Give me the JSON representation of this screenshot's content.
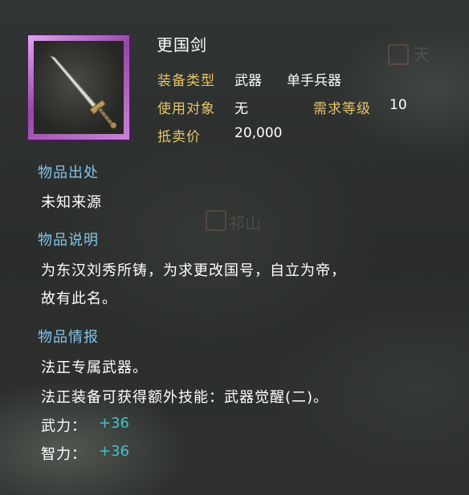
{
  "item": {
    "name": "更国剑",
    "icon": "sword-icon",
    "frame_color": "#c07ad2",
    "equip_type_label": "装备类型",
    "equip_type_value": "武器",
    "equip_subtype_value": "单手兵器",
    "user_label": "使用对象",
    "user_value": "无",
    "required_level_label": "需求等级",
    "required_level_value": "10",
    "sell_price_label": "抵卖价",
    "sell_price_value": "20,000"
  },
  "sections": {
    "origin_title": "物品出处",
    "origin_text": "未知来源",
    "description_title": "物品说明",
    "description_line1": "为东汉刘秀所铸，为求更改国号，自立为帝，",
    "description_line2": "故有此名。",
    "info_title": "物品情报",
    "info_line1": "法正专属武器。",
    "info_line2": "法正装备可获得额外技能：武器觉醒(二)。"
  },
  "stats": [
    {
      "label": "武力：",
      "value": "+36"
    },
    {
      "label": "智力：",
      "value": "+36"
    }
  ],
  "background_map": {
    "place1": "天",
    "place2": "祁山"
  },
  "colors": {
    "label_gold": "#e7c56a",
    "section_blue": "#84c4ea",
    "bonus_cyan": "#3fc3ce"
  }
}
